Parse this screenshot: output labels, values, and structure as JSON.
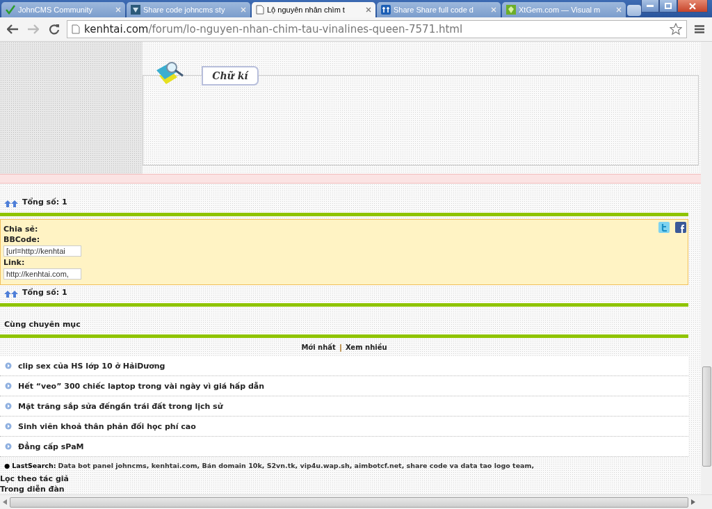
{
  "browser": {
    "tabs": [
      {
        "title": "JohnCMS Community",
        "selected": false,
        "kind": "check"
      },
      {
        "title": "Share code johncms sty",
        "selected": false,
        "kind": "tile"
      },
      {
        "title": "Lộ nguyên nhân chìm t",
        "selected": true,
        "kind": "page"
      },
      {
        "title": "Share Share full code d",
        "selected": false,
        "kind": "tools"
      },
      {
        "title": "XtGem.com — Visual m",
        "selected": false,
        "kind": "xtgem"
      }
    ],
    "address": {
      "host": "kenhtai.com",
      "path": "/forum/lo-nguyen-nhan-chim-tau-vinalines-queen-7571.html"
    }
  },
  "signature": {
    "title": "Chữ kí"
  },
  "total_top": "Tổng số: 1",
  "share": {
    "title": "Chia sẻ:",
    "fields": [
      {
        "label": "BBCode:",
        "value": "[url=http://kenhtai"
      },
      {
        "label": "Link:",
        "value": "http://kenhtai.com,"
      }
    ]
  },
  "total_bottom": "Tổng số: 1",
  "related": {
    "title": "Cùng chuyên mục",
    "tabs": [
      "Mới nhất",
      "Xem nhiều"
    ],
    "separator": "|",
    "items": [
      "clip sex của HS lớp 10 ở HảiDương",
      "Hết “veo” 300 chiếc laptop trong vài ngày vì giá hấp dẫn",
      "Mặt trăng sắp sửa đếngần trái đất trong lịch sử",
      "Sinh viên khoả thân phản đối học phí cao",
      "Đẳng cấp sPaM"
    ]
  },
  "last_search": {
    "bullet": "●",
    "label": "LastSearch:",
    "text": "Data bot panel johncms, kenhtai.com, Bán domain 10k, S2vn.tk, vip4u.wap.sh, aimbotcf.net, share code va data tao logo team,"
  },
  "footer_links": [
    "Lọc theo tác giả",
    "Trong diễn đàn"
  ]
}
